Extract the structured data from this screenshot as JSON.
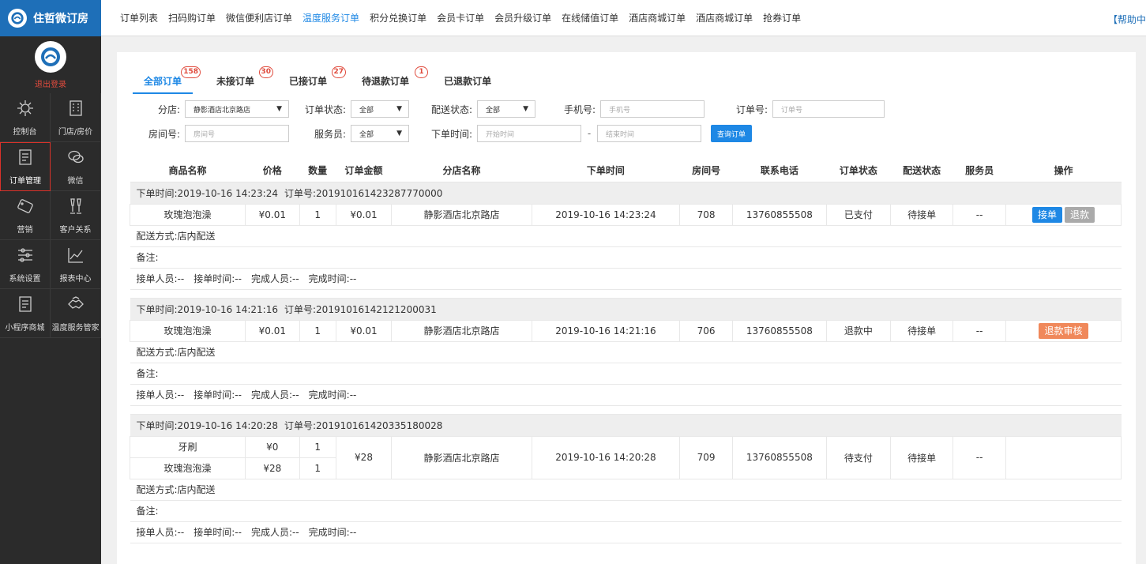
{
  "brand": {
    "name": "住哲微订房"
  },
  "user": {
    "logout": "退出登录"
  },
  "sidebar": [
    {
      "label": "控制台",
      "icon": "gear-icon"
    },
    {
      "label": "门店/房价",
      "icon": "building-icon"
    },
    {
      "label": "订单管理",
      "icon": "document-icon",
      "active": true
    },
    {
      "label": "微信",
      "icon": "wechat-icon"
    },
    {
      "label": "营销",
      "icon": "sale-tag-icon"
    },
    {
      "label": "客户关系",
      "icon": "glasses-icon"
    },
    {
      "label": "系统设置",
      "icon": "sliders-icon"
    },
    {
      "label": "报表中心",
      "icon": "line-chart-icon"
    },
    {
      "label": "小程序商城",
      "icon": "document-icon"
    },
    {
      "label": "温度服务管家",
      "icon": "handshake-icon"
    }
  ],
  "topnav": {
    "items": [
      "订单列表",
      "扫码购订单",
      "微信便利店订单",
      "温度服务订单",
      "积分兑换订单",
      "会员卡订单",
      "会员升级订单",
      "在线储值订单",
      "酒店商城订单",
      "酒店商城订单",
      "抢券订单"
    ],
    "active_index": 3,
    "help": "【帮助中"
  },
  "subtabs": [
    {
      "label": "全部订单",
      "badge": "158",
      "active": true
    },
    {
      "label": "未接订单",
      "badge": "30"
    },
    {
      "label": "已接订单",
      "badge": "27"
    },
    {
      "label": "待退款订单",
      "badge": "1"
    },
    {
      "label": "已退款订单",
      "badge": ""
    }
  ],
  "filters": {
    "branch_label": "分店:",
    "branch_value": "静影酒店北京路店",
    "order_status_label": "订单状态:",
    "order_status_value": "全部",
    "delivery_status_label": "配送状态:",
    "delivery_status_value": "全部",
    "phone_label": "手机号:",
    "phone_placeholder": "手机号",
    "order_no_label": "订单号:",
    "order_no_placeholder": "订单号",
    "room_label": "房间号:",
    "room_placeholder": "房间号",
    "waiter_label": "服务员:",
    "waiter_value": "全部",
    "time_label": "下单时间:",
    "start_placeholder": "开始时间",
    "dash": "-",
    "end_placeholder": "结束时间",
    "query_button": "查询订单"
  },
  "columns": [
    "商品名称",
    "价格",
    "数量",
    "订单金额",
    "分店名称",
    "下单时间",
    "房间号",
    "联系电话",
    "订单状态",
    "配送状态",
    "服务员",
    "操作"
  ],
  "labels": {
    "order_time": "下单时间:",
    "order_no": "订单号:",
    "delivery": "配送方式:",
    "remark": "备注:",
    "acceptor": "接单人员:",
    "accept_time": "接单时间:",
    "completer": "完成人员:",
    "complete_time": "完成时间:"
  },
  "orders": [
    {
      "time": "2019-10-16 14:23:24",
      "order_no": "201910161423287770000",
      "items": [
        {
          "name": "玫瑰泡泡澡",
          "price": "¥0.01",
          "qty": "1"
        }
      ],
      "amount": "¥0.01",
      "branch": "静影酒店北京路店",
      "order_time": "2019-10-16 14:23:24",
      "room": "708",
      "phone": "13760855508",
      "status": "已支付",
      "delivery_status": "待接单",
      "waiter": "--",
      "actions": [
        "接单",
        "退款"
      ],
      "delivery": "店内配送",
      "remark": "",
      "acceptor": "--",
      "accept_time": "--",
      "completer": "--",
      "complete_time": "--"
    },
    {
      "time": "2019-10-16 14:21:16",
      "order_no": "20191016142121200031",
      "items": [
        {
          "name": "玫瑰泡泡澡",
          "price": "¥0.01",
          "qty": "1"
        }
      ],
      "amount": "¥0.01",
      "branch": "静影酒店北京路店",
      "order_time": "2019-10-16 14:21:16",
      "room": "706",
      "phone": "13760855508",
      "status": "退款中",
      "delivery_status": "待接单",
      "waiter": "--",
      "actions": [
        "退款审核"
      ],
      "delivery": "店内配送",
      "remark": "",
      "acceptor": "--",
      "accept_time": "--",
      "completer": "--",
      "complete_time": "--"
    },
    {
      "time": "2019-10-16 14:20:28",
      "order_no": "201910161420335180028",
      "items": [
        {
          "name": "牙刷",
          "price": "¥0",
          "qty": "1"
        },
        {
          "name": "玫瑰泡泡澡",
          "price": "¥28",
          "qty": "1"
        }
      ],
      "amount": "¥28",
      "branch": "静影酒店北京路店",
      "order_time": "2019-10-16 14:20:28",
      "room": "709",
      "phone": "13760855508",
      "status": "待支付",
      "delivery_status": "待接单",
      "waiter": "--",
      "actions": [],
      "delivery": "店内配送",
      "remark": "",
      "acceptor": "--",
      "accept_time": "--",
      "completer": "--",
      "complete_time": "--"
    }
  ]
}
